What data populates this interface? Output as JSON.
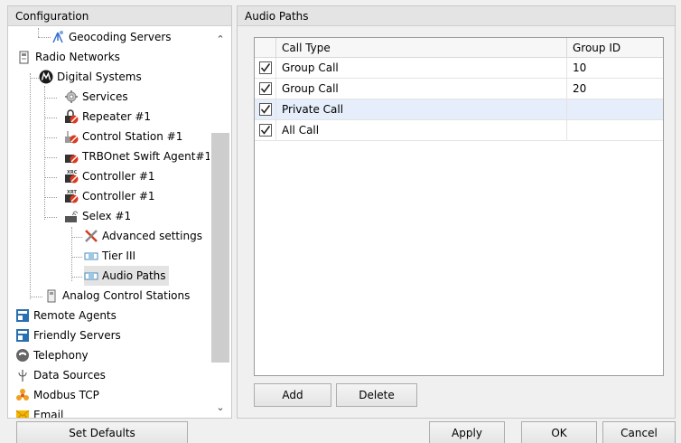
{
  "left_panel": {
    "title": "Configuration",
    "tree": [
      {
        "label": "Geocoding Servers",
        "icon": "geocoding-icon"
      },
      {
        "label": "Radio Networks",
        "icon": "radio-networks-icon"
      },
      {
        "label": "Digital Systems",
        "icon": "motorola-logo-icon"
      },
      {
        "label": "Services",
        "icon": "gear-icon"
      },
      {
        "label": "Repeater #1",
        "icon": "repeater-icon"
      },
      {
        "label": "Control Station #1",
        "icon": "control-station-icon"
      },
      {
        "label": "TRBOnet Swift Agent#1",
        "icon": "swift-agent-icon"
      },
      {
        "label": "Controller #1",
        "icon": "controller-xrc-icon",
        "badge": "XRC"
      },
      {
        "label": "Controller #1",
        "icon": "controller-xrt-icon",
        "badge": "XRT"
      },
      {
        "label": "Selex #1",
        "icon": "selex-icon"
      },
      {
        "label": "Advanced settings",
        "icon": "tools-icon"
      },
      {
        "label": "Tier III",
        "icon": "tier-icon"
      },
      {
        "label": "Audio Paths",
        "icon": "audio-paths-icon"
      },
      {
        "label": "Analog Control Stations",
        "icon": "analog-station-icon"
      },
      {
        "label": "Remote Agents",
        "icon": "remote-agents-icon"
      },
      {
        "label": "Friendly Servers",
        "icon": "friendly-servers-icon"
      },
      {
        "label": "Telephony",
        "icon": "telephony-icon"
      },
      {
        "label": "Data Sources",
        "icon": "data-sources-icon"
      },
      {
        "label": "Modbus TCP",
        "icon": "modbus-icon"
      },
      {
        "label": "Email",
        "icon": "email-icon"
      }
    ]
  },
  "right_panel": {
    "title": "Audio Paths",
    "columns": [
      "Call Type",
      "Group ID"
    ],
    "rows": [
      {
        "checked": true,
        "call_type": "Group Call",
        "group_id": "10"
      },
      {
        "checked": true,
        "call_type": "Group Call",
        "group_id": "20"
      },
      {
        "checked": true,
        "call_type": "Private Call",
        "group_id": ""
      },
      {
        "checked": true,
        "call_type": "All Call",
        "group_id": ""
      }
    ],
    "add_label": "Add",
    "delete_label": "Delete"
  },
  "footer": {
    "set_defaults_label": "Set Defaults",
    "apply_label": "Apply",
    "ok_label": "OK",
    "cancel_label": "Cancel"
  },
  "colors": {
    "selection": "#e5eefa",
    "motorola": "#1a1a1a",
    "red_badge": "#d8391f"
  }
}
